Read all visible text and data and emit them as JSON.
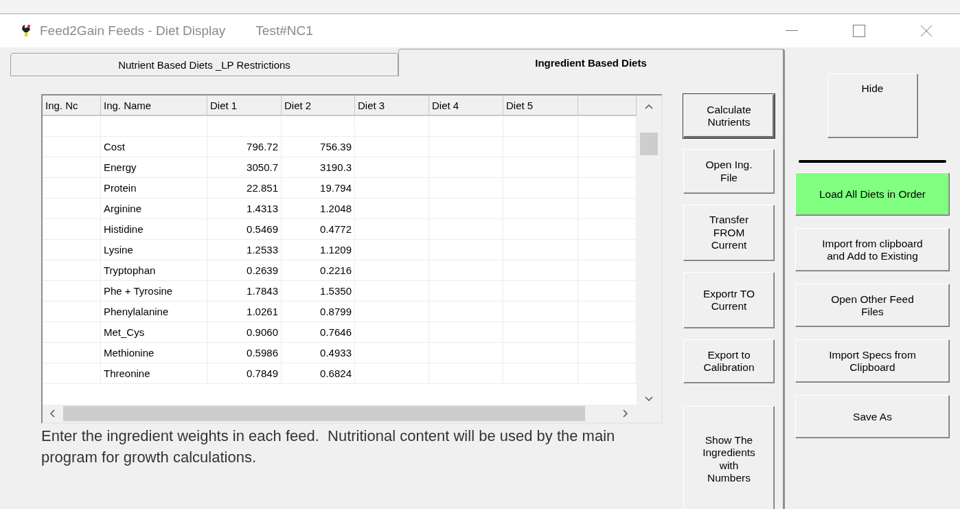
{
  "window": {
    "title": "Feed2Gain Feeds - Diet Display",
    "subtitle": "Test#NC1"
  },
  "tabs": [
    {
      "label": "Nutrient Based Diets _LP Restrictions",
      "selected": false
    },
    {
      "label": "Ingredient Based Diets",
      "selected": true
    }
  ],
  "table": {
    "columns": [
      "Ing. Nc",
      "Ing. Name",
      "Diet 1",
      "Diet 2",
      "Diet 3",
      "Diet 4",
      "Diet 5"
    ],
    "rows": [
      {
        "name": "",
        "diet_1": "",
        "diet_2": ""
      },
      {
        "name": "Cost",
        "diet_1": "796.72",
        "diet_2": "756.39"
      },
      {
        "name": "Energy",
        "diet_1": "3050.7",
        "diet_2": "3190.3"
      },
      {
        "name": "Protein",
        "diet_1": "22.851",
        "diet_2": "19.794"
      },
      {
        "name": "Arginine",
        "diet_1": "1.4313",
        "diet_2": "1.2048"
      },
      {
        "name": "Histidine",
        "diet_1": "0.5469",
        "diet_2": "0.4772"
      },
      {
        "name": "Lysine",
        "diet_1": "1.2533",
        "diet_2": "1.1209"
      },
      {
        "name": "Tryptophan",
        "diet_1": "0.2639",
        "diet_2": "0.2216"
      },
      {
        "name": "Phe + Tyrosine",
        "diet_1": "1.7843",
        "diet_2": "1.5350"
      },
      {
        "name": "Phenylalanine",
        "diet_1": "1.0261",
        "diet_2": "0.8799"
      },
      {
        "name": "Met_Cys",
        "diet_1": "0.9060",
        "diet_2": "0.7646"
      },
      {
        "name": "Methionine",
        "diet_1": "0.5986",
        "diet_2": "0.4933"
      },
      {
        "name": "Threonine",
        "diet_1": "0.7849",
        "diet_2": "0.6824"
      }
    ]
  },
  "instructions": "Enter the ingredient weights in each feed.  Nutritional content will be used by the main program for growth calculations.",
  "action_buttons": [
    {
      "label": "Calculate\nNutrients",
      "kind": "default"
    },
    {
      "label": "Open Ing.\nFile",
      "kind": "normal"
    },
    {
      "label": "Transfer\nFROM\nCurrent",
      "kind": "normal"
    },
    {
      "label": "Exportr TO\nCurrent",
      "kind": "normal"
    },
    {
      "label": "Export to\nCalibration",
      "kind": "normal"
    },
    {
      "label": "Show The\nIngredients\nwith\nNumbers",
      "kind": "normal"
    }
  ],
  "side_buttons": [
    {
      "label": "Hide",
      "kind": "plain"
    },
    {
      "label": "Load All Diets in Order",
      "kind": "highlighted"
    },
    {
      "label": "Import from clipboard\nand Add to Existing",
      "kind": "plain"
    },
    {
      "label": "Open Other Feed\nFiles",
      "kind": "plain"
    },
    {
      "label": "Import Specs from\nClipboard",
      "kind": "plain"
    },
    {
      "label": "Save As",
      "kind": "plain"
    }
  ]
}
